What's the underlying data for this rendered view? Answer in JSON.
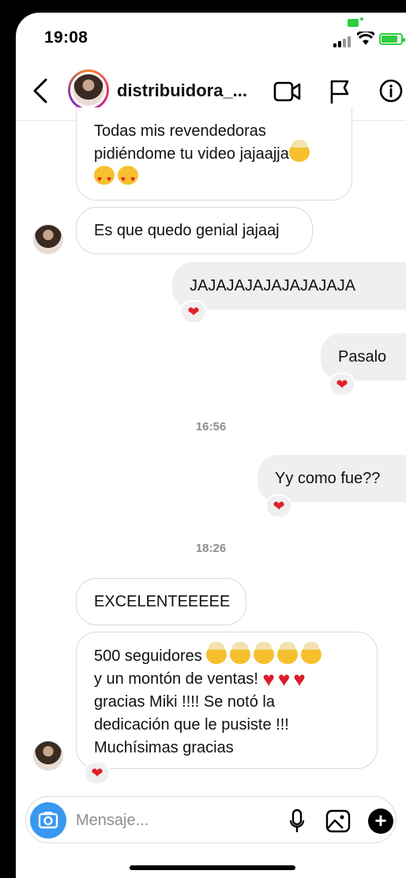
{
  "status_bar": {
    "time": "19:08"
  },
  "header": {
    "username": "distribuidora_..."
  },
  "messages": [
    {
      "text_line1": "Todas mis revendedoras",
      "text_line2": "pidiéndome tu video jajaajja"
    },
    {
      "text": "Es que quedo genial jajaaj"
    },
    {
      "text": "JAJAJAJAJAJAJAJAJA",
      "reaction": "❤"
    },
    {
      "text": "Pasalo",
      "reaction": "❤"
    },
    {
      "text": "Yy como fue??",
      "reaction": "❤"
    },
    {
      "text": "EXCELENTEEEEE"
    },
    {
      "line1": "500 seguidores",
      "line2": "y un montón de ventas!",
      "line3": "gracias Miki !!!! Se notó la",
      "line4": "dedicación que le pusiste !!!",
      "line5": "Muchísimas gracias",
      "reaction": "❤"
    }
  ],
  "timestamps": [
    "16:56",
    "18:26"
  ],
  "composer": {
    "placeholder": "Mensaje..."
  },
  "icons": [
    "back-icon",
    "video-call-icon",
    "flag-icon",
    "info-icon",
    "camera-icon",
    "microphone-icon",
    "gallery-icon",
    "plus-icon"
  ],
  "colors": {
    "reaction_heart": "#e0202a",
    "camera_button": "#3897f0",
    "battery": "#2ecc40"
  }
}
